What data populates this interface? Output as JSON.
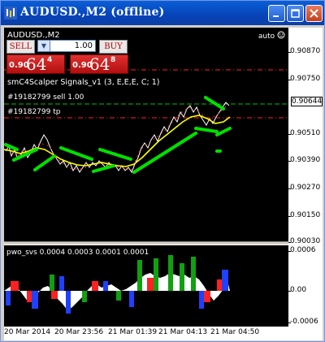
{
  "window": {
    "title": "AUDUSD.,M2 (offline)"
  },
  "chart": {
    "symbol": "AUDUSD.,M2",
    "auto_label": "auto",
    "indicator_label": "smC4Scalper Signals_v1 (3, E,E,E, C; 1)",
    "order_sell_label": "#19182799 sell 1.00",
    "order_tp_label": "#19182799 tp",
    "current_price": "0.90644"
  },
  "trade_panel": {
    "sell_label": "SELL",
    "buy_label": "BUY",
    "lot_value": "1.00",
    "sell_quote": {
      "prefix": "0.90",
      "big": "64",
      "sup": "4"
    },
    "buy_quote": {
      "prefix": "0.90",
      "big": "64",
      "sup": "8"
    }
  },
  "price_axis": [
    "0.90870",
    "0.90750",
    "0.90630",
    "0.90510",
    "0.90390",
    "0.90270",
    "0.90150",
    "0.90030"
  ],
  "sub_axis": [
    "0.0006",
    "0.00",
    "-0.0006"
  ],
  "subwindow": {
    "label": "pwo_svs 0.0004 0.0003 0.0001 0.0001"
  },
  "time_axis": [
    "20 Mar 2014",
    "20 Mar 23:56",
    "21 Mar 01:39",
    "21 Mar 04:13",
    "21 Mar 04:50"
  ],
  "colors": {
    "background": "#000000",
    "bull_bar": "#ffffff",
    "bear_bar": "#ff3030",
    "signal": "#00e000",
    "ma": "#ffff00",
    "sell_line": "#00c000",
    "tp_line": "#ff2020"
  }
}
